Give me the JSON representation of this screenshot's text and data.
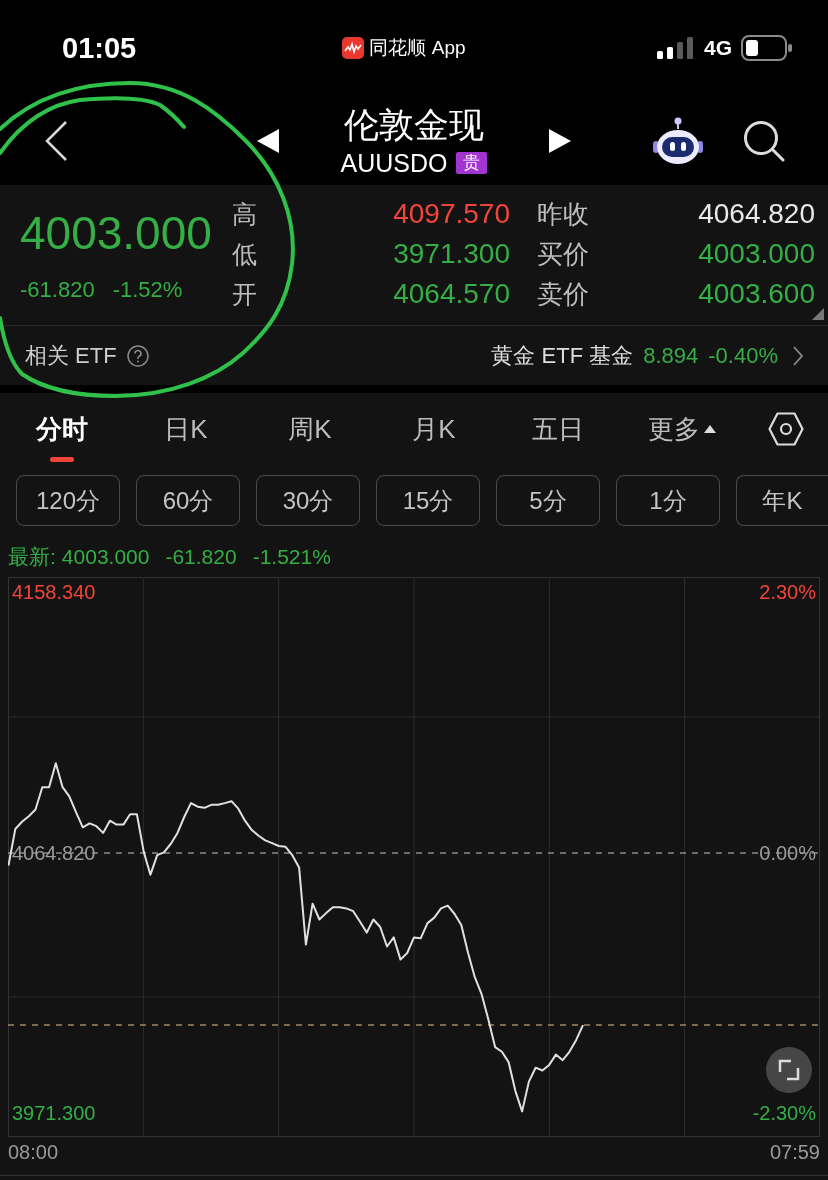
{
  "status_bar": {
    "time": "01:05",
    "app": "同花顺 App",
    "network": "4G"
  },
  "header": {
    "title": "伦敦金现",
    "code": "AUUSDO",
    "badge": "贵"
  },
  "annotations": [
    {
      "kind": "circle"
    }
  ],
  "quote": {
    "price": "4003.000",
    "change": "-61.820",
    "change_pct": "-1.52%",
    "rising": false,
    "stats": [
      {
        "label": "高",
        "value": "4097.570",
        "color": "#f2453a"
      },
      {
        "label": "低",
        "value": "3971.300",
        "color": "#35ae45"
      },
      {
        "label": "开",
        "value": "4064.570",
        "color": "#35ae45"
      }
    ],
    "details": [
      {
        "label": "昨收",
        "value": "4064.820",
        "color": "#e8e8e8"
      },
      {
        "label": "买价",
        "value": "4003.000",
        "color": "#35ae45"
      },
      {
        "label": "卖价",
        "value": "4003.600",
        "color": "#35ae45"
      }
    ]
  },
  "related_etf": {
    "label": "相关 ETF",
    "name": "黄金 ETF 基金",
    "price": "8.894",
    "change_pct": "-0.40%",
    "rising": false
  },
  "tabs": [
    {
      "label": "分时",
      "selected": true,
      "kind": "text"
    },
    {
      "label": "日K",
      "selected": false,
      "kind": "text"
    },
    {
      "label": "周K",
      "selected": false,
      "kind": "text"
    },
    {
      "label": "月K",
      "selected": false,
      "kind": "text"
    },
    {
      "label": "五日",
      "selected": false,
      "kind": "text"
    },
    {
      "label": "更多",
      "selected": false,
      "kind": "menu"
    }
  ],
  "periods": [
    "120分",
    "60分",
    "30分",
    "15分",
    "5分",
    "1分",
    "年K"
  ],
  "latest": {
    "label": "最新:",
    "price": "4003.000",
    "change": "-61.820",
    "change_pct": "-1.521%",
    "rising": false
  },
  "chart": {
    "right_labels": [
      "2.30%",
      "0.00%",
      "-2.30%"
    ],
    "time_labels": [
      "08:00",
      "07:59"
    ],
    "chart_data": {
      "type": "line",
      "grid": true,
      "ylim": [
        3963.0,
        4163.7
      ],
      "yticks": [
        {
          "value": 4158.34,
          "label": "4158.340"
        },
        {
          "value": 4064.82,
          "label": "4064.820"
        },
        {
          "value": 3971.3,
          "label": "3971.300"
        }
      ],
      "ref_lines": [
        {
          "axis": "y",
          "value": 4064.82,
          "color": "#8a8a8a"
        },
        {
          "axis": "y",
          "value": 4003.0,
          "color": "#a08a62"
        }
      ],
      "series": [
        {
          "color": "#e0e0e0",
          "values": [
            4060.3,
            4073.4,
            4076.0,
            4078.0,
            4080.4,
            4088.4,
            4088.4,
            4097.0,
            4088.4,
            4085.1,
            4079.4,
            4074.0,
            4075.4,
            4074.4,
            4072.0,
            4076.4,
            4075.0,
            4075.0,
            4078.7,
            4078.7,
            4065.3,
            4057.0,
            4064.0,
            4065.0,
            4068.0,
            4072.0,
            4077.7,
            4082.7,
            4081.4,
            4081.0,
            4082.1,
            4082.1,
            4082.7,
            4083.4,
            4080.7,
            4076.4,
            4073.0,
            4071.0,
            4069.3,
            4068.3,
            4067.3,
            4067.0,
            4064.0,
            4059.6,
            4031.9,
            4046.6,
            4040.9,
            4043.2,
            4045.3,
            4045.3,
            4044.9,
            4043.9,
            4040.2,
            4036.2,
            4040.9,
            4038.2,
            4031.2,
            4034.5,
            4026.5,
            4028.9,
            4034.5,
            4034.2,
            4039.6,
            4041.6,
            4044.9,
            4045.9,
            4042.9,
            4038.9,
            4028.9,
            4020.2,
            4014.1,
            4005.1,
            3995.1,
            3993.4,
            3989.7,
            3979.3,
            3972.0,
            3982.7,
            3987.7,
            3986.7,
            3988.7,
            3992.4,
            3990.4,
            3993.4,
            3997.7,
            4003.0,
            null,
            null,
            null,
            null,
            null,
            null,
            null,
            null,
            null,
            null,
            null,
            null,
            null,
            null,
            null,
            null,
            null,
            null,
            null,
            null,
            null,
            null,
            null,
            null,
            null,
            null,
            null,
            null,
            null,
            null,
            null,
            null,
            null,
            null,
            null
          ]
        }
      ]
    }
  }
}
